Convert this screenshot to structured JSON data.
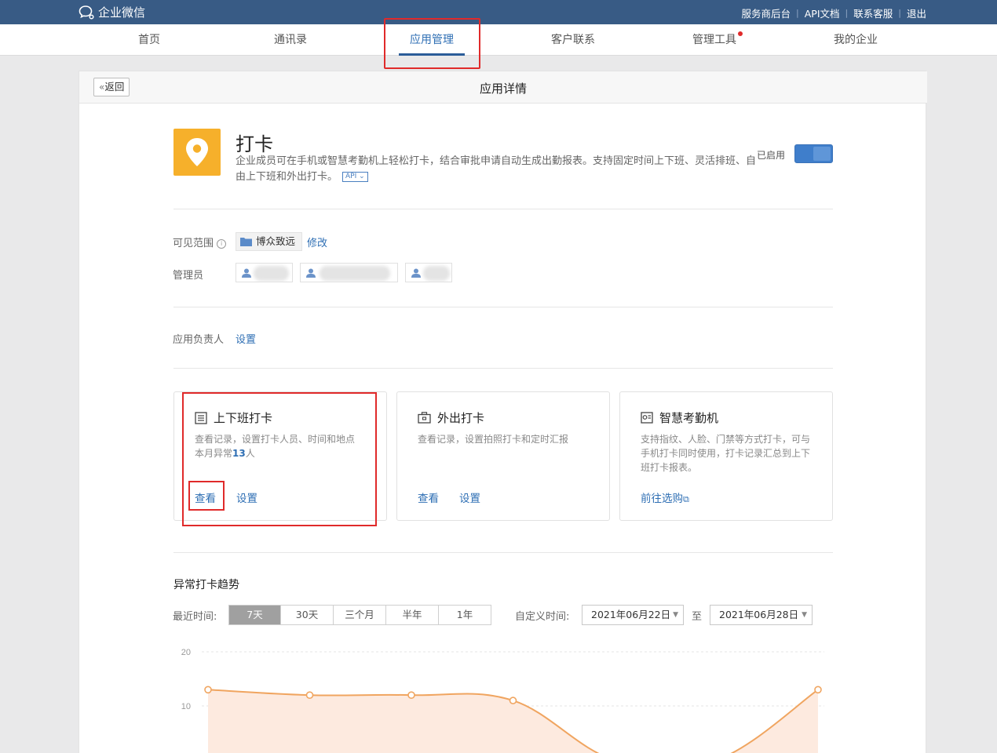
{
  "topbar": {
    "logo_text": "企业微信",
    "links": [
      "服务商后台",
      "API文档",
      "联系客服",
      "退出"
    ]
  },
  "nav": {
    "items": [
      "首页",
      "通讯录",
      "应用管理",
      "客户联系",
      "管理工具",
      "我的企业"
    ],
    "active": "应用管理"
  },
  "panel": {
    "back_label": "返回",
    "title": "应用详情"
  },
  "app": {
    "name": "打卡",
    "description": "企业成员可在手机或智慧考勤机上轻松打卡，结合审批申请自动生成出勤报表。支持固定时间上下班、灵活排班、自由上下班和外出打卡。",
    "api_tag": "API",
    "status_label": "已启用",
    "enabled": true,
    "icon": "location-pin-icon",
    "icon_color": "#f6b02b"
  },
  "visibility": {
    "label": "可见范围",
    "scope": "博众致远",
    "edit_label": "修改"
  },
  "admins": {
    "label": "管理员",
    "items": [
      "",
      "",
      ""
    ]
  },
  "owner": {
    "label": "应用负责人",
    "set_label": "设置"
  },
  "cards": [
    {
      "title": "上下班打卡",
      "icon": "list-icon",
      "desc_line1": "查看记录，设置打卡人员、时间和地点",
      "desc_prefix": "本月异常",
      "desc_count": "13",
      "desc_suffix": "人",
      "link1": "查看",
      "link2": "设置"
    },
    {
      "title": "外出打卡",
      "icon": "briefcase-icon",
      "desc_line1": "查看记录，设置拍照打卡和定时汇报",
      "link1": "查看",
      "link2": "设置"
    },
    {
      "title": "智慧考勤机",
      "icon": "device-icon",
      "desc_line1": "支持指纹、人脸、门禁等方式打卡，可与手机打卡同时使用，打卡记录汇总到上下班打卡报表。",
      "link1": "前往选购"
    }
  ],
  "trend": {
    "title": "异常打卡趋势",
    "recent_label": "最近时间:",
    "ranges": [
      "7天",
      "30天",
      "三个月",
      "半年",
      "1年"
    ],
    "active_range": "7天",
    "custom_label": "自定义时间:",
    "date_from": "2021年06月22日",
    "to_label": "至",
    "date_to": "2021年06月28日"
  },
  "chart_data": {
    "type": "area",
    "ytick_labels": [
      "20",
      "10"
    ],
    "ylim": [
      0,
      20
    ],
    "values": [
      13,
      12,
      12,
      11,
      0,
      0,
      13
    ],
    "color": "#f0a560",
    "fill": "#fdeadf"
  }
}
